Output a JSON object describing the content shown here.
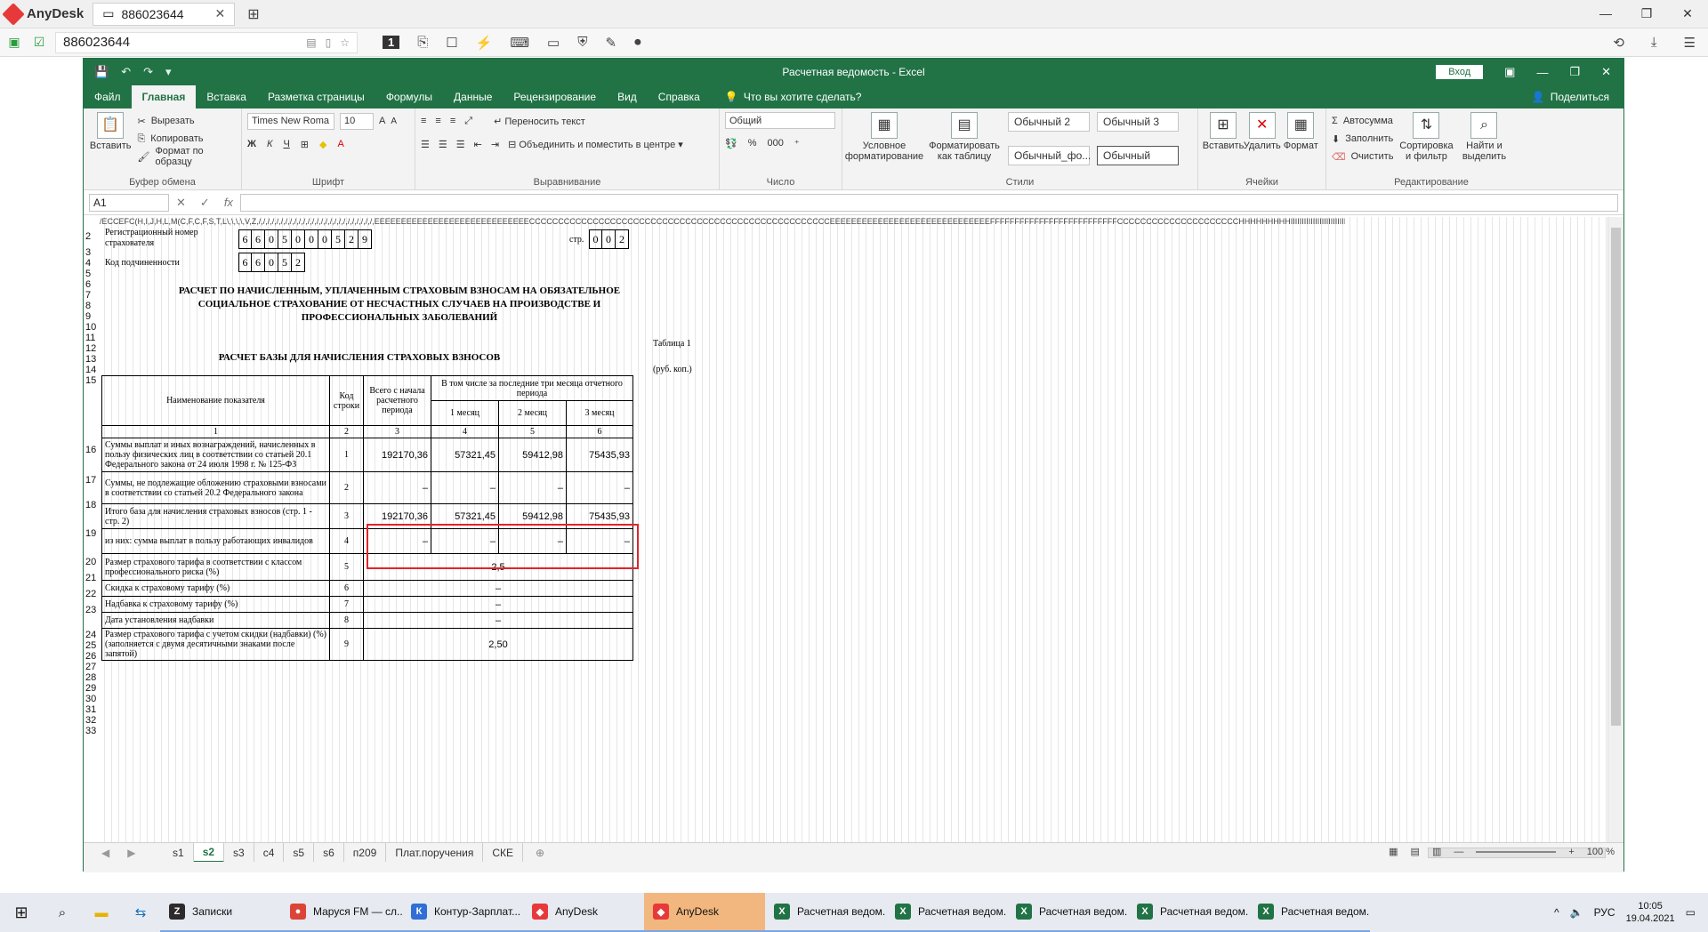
{
  "anydesk": {
    "brand": "AnyDesk",
    "tab_label": "886023644",
    "address": "886023644",
    "ui_color": "#e8393a"
  },
  "excel": {
    "title": "Расчетная ведомость  -  Excel",
    "signin": "Вход",
    "tabs": [
      "Файл",
      "Главная",
      "Вставка",
      "Разметка страницы",
      "Формулы",
      "Данные",
      "Рецензирование",
      "Вид",
      "Справка"
    ],
    "search": "Что вы хотите сделать?",
    "share": "Поделиться",
    "accent": "#217346",
    "ribbon": {
      "clipboard": {
        "paste": "Вставить",
        "cut": "Вырезать",
        "copy": "Копировать",
        "format_painter": "Формат по образцу",
        "group": "Буфер обмена"
      },
      "font": {
        "name": "Times New Roma",
        "size": "10",
        "group": "Шрифт"
      },
      "align": {
        "wrap": "Переносить текст",
        "merge": "Объединить и поместить в центре",
        "group": "Выравнивание"
      },
      "number": {
        "format": "Общий",
        "group": "Число"
      },
      "styles": {
        "cond": "Условное форматирование",
        "table": "Форматировать как таблицу",
        "s1": "Обычный 2",
        "s2": "Обычный 3",
        "s3": "Обычный_фо...",
        "s4": "Обычный",
        "group": "Стили"
      },
      "cells": {
        "insert": "Вставить",
        "delete": "Удалить",
        "format": "Формат",
        "group": "Ячейки"
      },
      "editing": {
        "autosum": "Автосумма",
        "fill": "Заполнить",
        "clear": "Очистить",
        "sort": "Сортировка и фильтр",
        "find": "Найти и выделить",
        "group": "Редактирование"
      }
    },
    "namebox": "A1",
    "header_strip": "/ECCEFC(H,I,J,H,L,M(C,F,C,F,S,T,L\\,\\,\\,\\,V,Z,/,/,/,/,/,/,/,/,/,/,/,/,/,/,/,/,/,/,/,/,/,/,/,/,/,/,EEEEEEEEEEEEEEEEEEEEEEEEEEEEECCCCCCCCCCCCCCCCCCCCCCCCCCCCCCCCCCCCCCCCCCCCCCCCCCCCEEEEEEEEEEEEEEEEEEEEEEEEEEEEEEFFFFFFFFFFFFFFFFFFFFFFFFFFCCCCCCCCCCCCCCCCCCCCCHHHHHHHHHIIIIIIIIIIIIIIIIIIIIIIIIIIIIIIIMMMMMMMMM",
    "sheets": [
      "s1",
      "s2",
      "s3",
      "c4",
      "s5",
      "s6",
      "п209",
      "Плат.поручения",
      "СКЕ"
    ],
    "active_sheet": "s2",
    "zoom": "100 %"
  },
  "form": {
    "reg_label": "Регистрационный номер страхователя",
    "reg_digits": [
      "6",
      "6",
      "0",
      "5",
      "0",
      "0",
      "0",
      "5",
      "2",
      "9"
    ],
    "page_label": "стр.",
    "page_digits": [
      "0",
      "0",
      "2"
    ],
    "sub_label": "Код подчиненности",
    "sub_digits": [
      "6",
      "6",
      "0",
      "5",
      "2"
    ],
    "title_l1": "РАСЧЕТ ПО НАЧИСЛЕННЫМ, УПЛАЧЕННЫМ СТРАХОВЫМ ВЗНОСАМ НА ОБЯЗАТЕЛЬНОЕ",
    "title_l2": "СОЦИАЛЬНОЕ СТРАХОВАНИЕ ОТ НЕСЧАСТНЫХ СЛУЧАЕВ НА ПРОИЗВОДСТВЕ И",
    "title_l3": "ПРОФЕССИОНАЛЬНЫХ ЗАБОЛЕВАНИЙ",
    "table_no": "Таблица 1",
    "table_title": "РАСЧЕТ БАЗЫ ДЛЯ НАЧИСЛЕНИЯ СТРАХОВЫХ ВЗНОСОВ",
    "units": "(руб. коп.)",
    "head": {
      "name": "Наименование показателя",
      "code": "Код строки",
      "total": "Всего с начала расчетного периода",
      "last3": "В том числе за последние три месяца отчетного периода",
      "m1": "1 месяц",
      "m2": "2 месяц",
      "m3": "3 месяц",
      "n1": "1",
      "n2": "2",
      "n3": "3",
      "n4": "4",
      "n5": "5",
      "n6": "6"
    },
    "rows": [
      {
        "name": "Суммы выплат и иных вознаграждений, начисленных в пользу физических лиц в соответствии со статьей 20.1 Федерального закона от 24 июля 1998 г. № 125-ФЗ",
        "code": "1",
        "total": "192170,36",
        "m1": "57321,45",
        "m2": "59412,98",
        "m3": "75435,93"
      },
      {
        "name": "Суммы, не подлежащие обложению страховыми взносами в соответствии со статьей 20.2 Федерального закона",
        "code": "2",
        "total": "–",
        "m1": "–",
        "m2": "–",
        "m3": "–"
      },
      {
        "name": "Итого база для начисления страховых взносов (стр. 1 - стр. 2)",
        "code": "3",
        "total": "192170,36",
        "m1": "57321,45",
        "m2": "59412,98",
        "m3": "75435,93"
      },
      {
        "name": "из них: сумма выплат в пользу работающих инвалидов",
        "code": "4",
        "total": "–",
        "m1": "–",
        "m2": "–",
        "m3": "–"
      }
    ],
    "merged_rows": [
      {
        "name": "Размер страхового тарифа в соответствии с классом профессионального риска (%)",
        "code": "5",
        "value": "2,5"
      },
      {
        "name": "Скидка к страховому тарифу (%)",
        "code": "6",
        "value": "–"
      },
      {
        "name": "Надбавка к страховому тарифу (%)",
        "code": "7",
        "value": "–"
      },
      {
        "name": "Дата установления надбавки",
        "code": "8",
        "value": "–"
      },
      {
        "name": "Размер страхового тарифа с учетом скидки (надбавки) (%) (заполняется с двумя десятичными знаками после запятой)",
        "code": "9",
        "value": "2,50"
      }
    ],
    "row_numbers": [
      "2",
      "3",
      "4",
      "5",
      "6",
      "7",
      "8",
      "9",
      "10",
      "11",
      "12",
      "13",
      "14",
      "15",
      "16",
      "17",
      "18",
      "19",
      "20",
      "21",
      "22",
      "23",
      "24",
      "25",
      "26",
      "27",
      "28",
      "29",
      "30",
      "31",
      "32",
      "33"
    ]
  },
  "taskbar": {
    "apps": [
      {
        "label": "Записки",
        "color": "#2b2b2b",
        "glyph": "Z"
      },
      {
        "label": "Маруся FM — сл...",
        "color": "#db4437",
        "glyph": "●"
      },
      {
        "label": "Контур-Зарплат...",
        "color": "#2f6fd6",
        "glyph": "К"
      },
      {
        "label": "AnyDesk",
        "color": "#e8393a",
        "glyph": "◆"
      },
      {
        "label": "AnyDesk",
        "color": "#e8393a",
        "glyph": "◆"
      },
      {
        "label": "Расчетная ведом...",
        "color": "#217346",
        "glyph": "X"
      },
      {
        "label": "Расчетная ведом...",
        "color": "#217346",
        "glyph": "X"
      },
      {
        "label": "Расчетная ведом...",
        "color": "#217346",
        "glyph": "X"
      },
      {
        "label": "Расчетная ведом...",
        "color": "#217346",
        "glyph": "X"
      },
      {
        "label": "Расчетная ведом...",
        "color": "#217346",
        "glyph": "X"
      }
    ],
    "lang": "РУС",
    "time": "10:05",
    "date": "19.04.2021"
  }
}
